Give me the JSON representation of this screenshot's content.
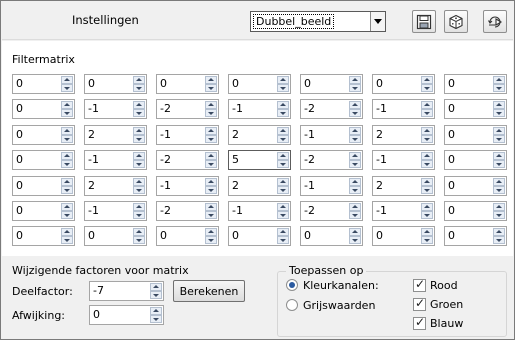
{
  "header": {
    "title": "Instellingen",
    "preset_value": "Dubbel_beeld",
    "icons": [
      "save-icon",
      "randomize-icon",
      "reset-icon"
    ]
  },
  "matrix": {
    "label": "Filtermatrix",
    "rows": [
      [
        "0",
        "0",
        "0",
        "0",
        "0",
        "0",
        "0"
      ],
      [
        "0",
        "-1",
        "-2",
        "-1",
        "-2",
        "-1",
        "0"
      ],
      [
        "0",
        "2",
        "-1",
        "2",
        "-1",
        "2",
        "0"
      ],
      [
        "0",
        "-1",
        "-2",
        "5",
        "-2",
        "-1",
        "0"
      ],
      [
        "0",
        "2",
        "-1",
        "2",
        "-1",
        "2",
        "0"
      ],
      [
        "0",
        "-1",
        "-2",
        "-1",
        "-2",
        "-1",
        "0"
      ],
      [
        "0",
        "0",
        "0",
        "0",
        "0",
        "0",
        "0"
      ]
    ]
  },
  "factors": {
    "title": "Wijzigende factoren voor matrix",
    "divisor_label": "Deelfactor:",
    "divisor_value": "-7",
    "calculate_label": "Berekenen",
    "bias_label": "Afwijking:",
    "bias_value": "0"
  },
  "apply": {
    "title": "Toepassen op",
    "color_channels_label": "Kleurkanalen:",
    "grayscale_label": "Grijswaarden",
    "red_label": "Rood",
    "green_label": "Groen",
    "blue_label": "Blauw"
  }
}
